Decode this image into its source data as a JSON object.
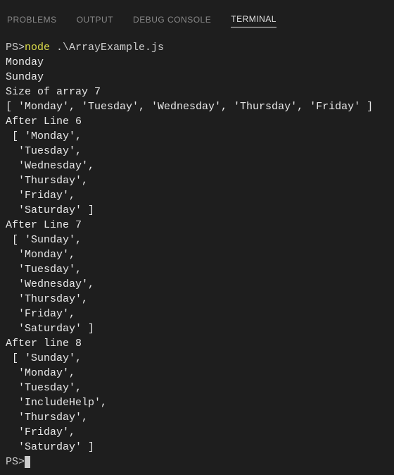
{
  "tabs": {
    "problems": "PROBLEMS",
    "output": "OUTPUT",
    "debug_console": "DEBUG CONSOLE",
    "terminal": "TERMINAL"
  },
  "terminal": {
    "prompt1": "PS>",
    "command_node": "node",
    "command_arg": " .\\ArrayExample.js",
    "lines": [
      "Monday",
      "Sunday",
      "Size of array 7",
      "[ 'Monday', 'Tuesday', 'Wednesday', 'Thursday', 'Friday' ]",
      "After Line 6",
      " [ 'Monday',",
      "  'Tuesday',",
      "  'Wednesday',",
      "  'Thursday',",
      "  'Friday',",
      "  'Saturday' ]",
      "After Line 7",
      " [ 'Sunday',",
      "  'Monday',",
      "  'Tuesday',",
      "  'Wednesday',",
      "  'Thursday',",
      "  'Friday',",
      "  'Saturday' ]",
      "After line 8",
      " [ 'Sunday',",
      "  'Monday',",
      "  'Tuesday',",
      "  'IncludeHelp',",
      "  'Thursday',",
      "  'Friday',",
      "  'Saturday' ]"
    ],
    "prompt2": "PS>"
  }
}
